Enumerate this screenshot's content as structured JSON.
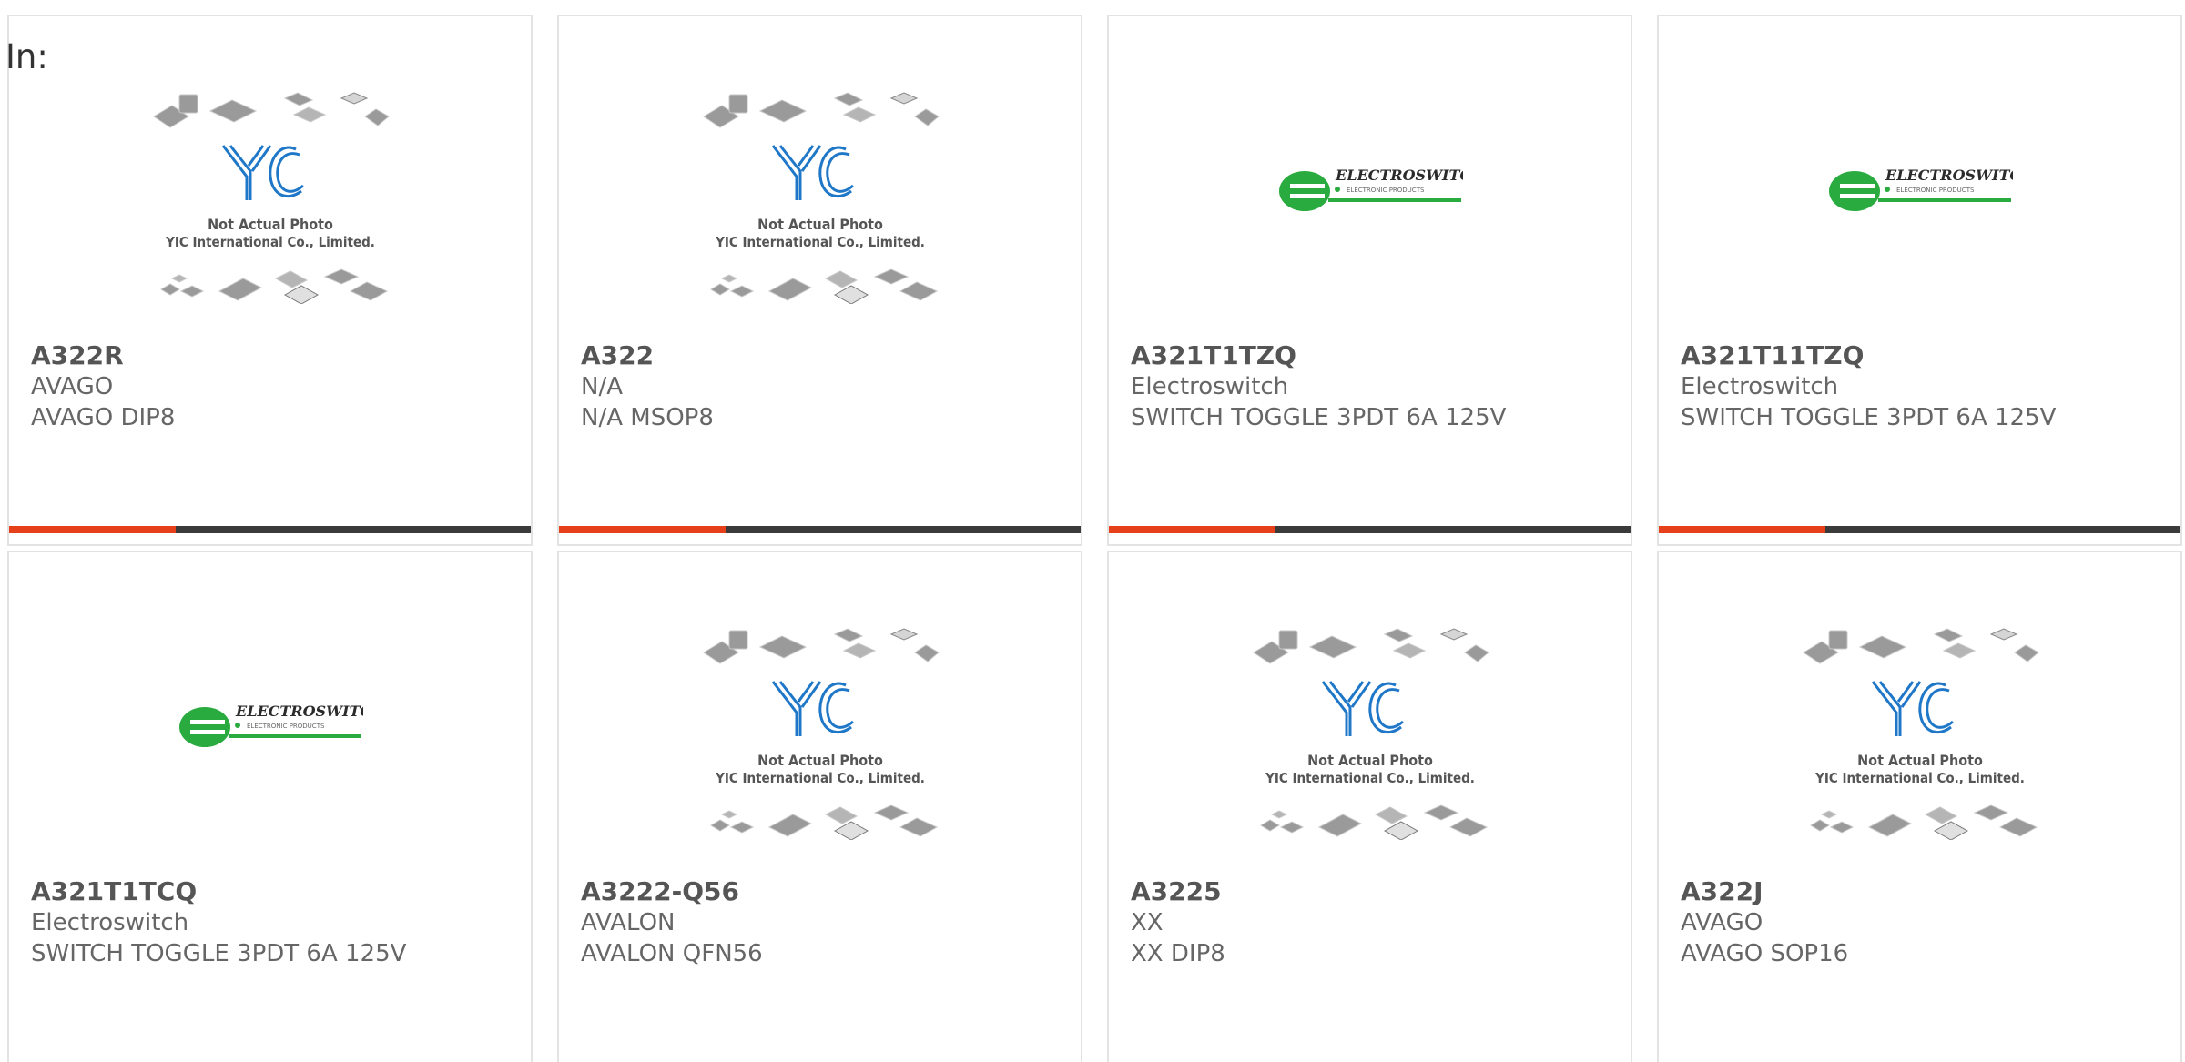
{
  "page": {
    "in_label": "In:"
  },
  "colors": {
    "accent_orange": "#e5401a",
    "bar_dark": "#3a3a3a",
    "yic_blue": "#1f77c8",
    "electroswitch_green": "#2aab3f"
  },
  "yic_placeholder": {
    "line1": "Not Actual Photo",
    "line2": "YIC International Co., Limited.",
    "logo_text": "YIC"
  },
  "electroswitch_logo": {
    "brand": "ELECTROSWITCH",
    "tagline": "ELECTRONIC PRODUCTS"
  },
  "products": [
    {
      "part": "A322R",
      "manufacturer": "AVAGO",
      "description": "AVAGO DIP8",
      "image": "yic-placeholder"
    },
    {
      "part": "A322",
      "manufacturer": "N/A",
      "description": "N/A MSOP8",
      "image": "yic-placeholder"
    },
    {
      "part": "A321T1TZQ",
      "manufacturer": "Electroswitch",
      "description": "SWITCH TOGGLE 3PDT 6A 125V",
      "image": "electroswitch-logo"
    },
    {
      "part": "A321T11TZQ",
      "manufacturer": "Electroswitch",
      "description": "SWITCH TOGGLE 3PDT 6A 125V",
      "image": "electroswitch-logo"
    },
    {
      "part": "A321T1TCQ",
      "manufacturer": "Electroswitch",
      "description": "SWITCH TOGGLE 3PDT 6A 125V",
      "image": "electroswitch-logo"
    },
    {
      "part": "A3222-Q56",
      "manufacturer": "AVALON",
      "description": "AVALON QFN56",
      "image": "yic-placeholder"
    },
    {
      "part": "A3225",
      "manufacturer": "XX",
      "description": "XX DIP8",
      "image": "yic-placeholder"
    },
    {
      "part": "A322J",
      "manufacturer": "AVAGO",
      "description": "AVAGO SOP16",
      "image": "yic-placeholder"
    }
  ]
}
